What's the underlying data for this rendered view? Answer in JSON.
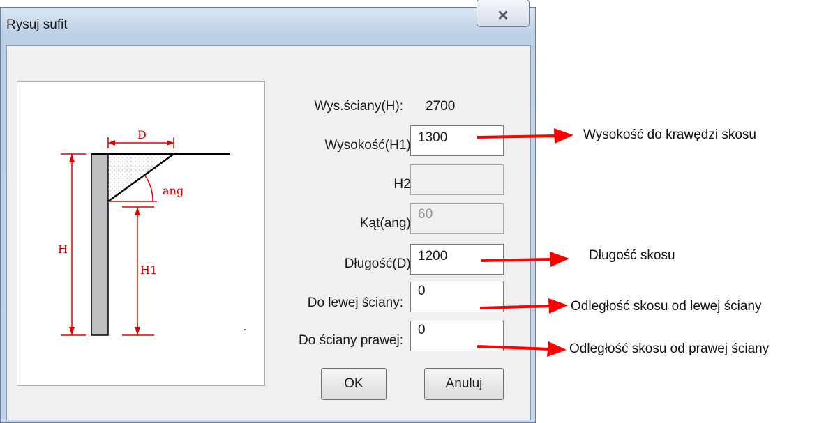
{
  "dialog": {
    "title": "Rysuj sufit",
    "close_icon": "close-icon",
    "ok_label": "OK",
    "cancel_label": "Anuluj"
  },
  "form": {
    "wall_height_label": "Wys.ściany(H):",
    "wall_height_value": "2700",
    "height_h1_label": "Wysokość(H1):",
    "height_h1_value": "1300",
    "h2_label": "H2:",
    "h2_value": "",
    "angle_label": "Kąt(ang):",
    "angle_value": "60",
    "length_label": "Długość(D):",
    "length_value": "1200",
    "left_wall_label": "Do lewej ściany:",
    "left_wall_value": "0",
    "right_wall_label": "Do ściany prawej:",
    "right_wall_value": "0"
  },
  "diagram": {
    "label_d": "D",
    "label_ang": "ang",
    "label_h": "H",
    "label_h1": "H1"
  },
  "annotations": {
    "height_note": "Wysokość do krawędzi skosu",
    "length_note": "Długość skosu",
    "left_note": "Odległość skosu od lewej ściany",
    "right_note": "Odległość skosu od prawej ściany"
  },
  "colors": {
    "annotation_red": "#ff0000",
    "diagram_red": "#e00000"
  }
}
